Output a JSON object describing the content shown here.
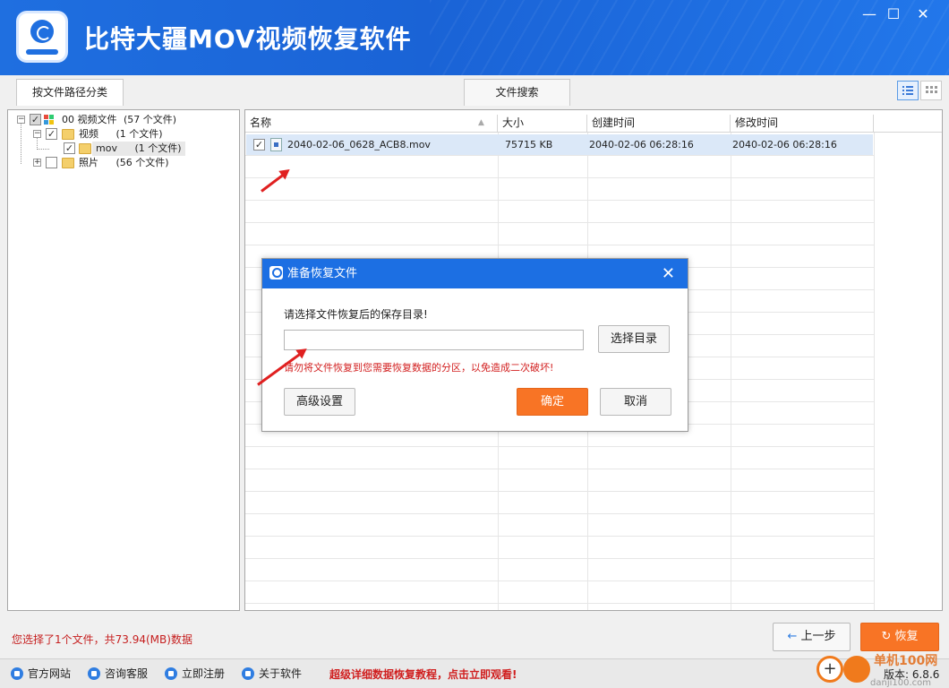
{
  "window": {
    "title": "比特大疆MOV视频恢复软件",
    "minimize": "—",
    "maximize": "☐",
    "close": "✕"
  },
  "tabs": [
    {
      "label": "按文件路径分类"
    },
    {
      "label": "文件搜索"
    }
  ],
  "tree": {
    "root": {
      "label": "00 视频文件",
      "count": "(57 个文件)"
    },
    "video": {
      "label": "视频",
      "count": "(1 个文件)"
    },
    "mov": {
      "label": "mov",
      "count": "(1 个文件)"
    },
    "photo": {
      "label": "照片",
      "count": "(56 个文件)"
    }
  },
  "list": {
    "columns": [
      "名称",
      "大小",
      "创建时间",
      "修改时间"
    ],
    "rows": [
      {
        "name": "2040-02-06_0628_ACB8.mov",
        "size": "75715 KB",
        "created": "2040-02-06  06:28:16",
        "modified": "2040-02-06  06:28:16",
        "checked": true
      }
    ]
  },
  "dialog": {
    "title": "准备恢复文件",
    "prompt": "请选择文件恢复后的保存目录!",
    "path_value": "",
    "choose_dir": "选择目录",
    "warning": "请勿将文件恢复到您需要恢复数据的分区，以免造成二次破坏!",
    "advanced": "高级设置",
    "ok": "确定",
    "cancel": "取消"
  },
  "status": {
    "message": "您选择了1个文件，共73.94(MB)数据"
  },
  "nav": {
    "prev": "上一步",
    "recover": "恢复"
  },
  "footer": {
    "links": [
      "官方网站",
      "咨询客服",
      "立即注册",
      "关于软件"
    ],
    "promo": "超级详细数据恢复教程，点击立即观看!",
    "version": "版本: 6.8.6"
  },
  "watermark": {
    "brand": "单机100网",
    "site": "danji100.com"
  },
  "colors": {
    "titlebar": "#1f6fe0",
    "accent_orange": "#f87425",
    "warning_red": "#d21f1f"
  }
}
